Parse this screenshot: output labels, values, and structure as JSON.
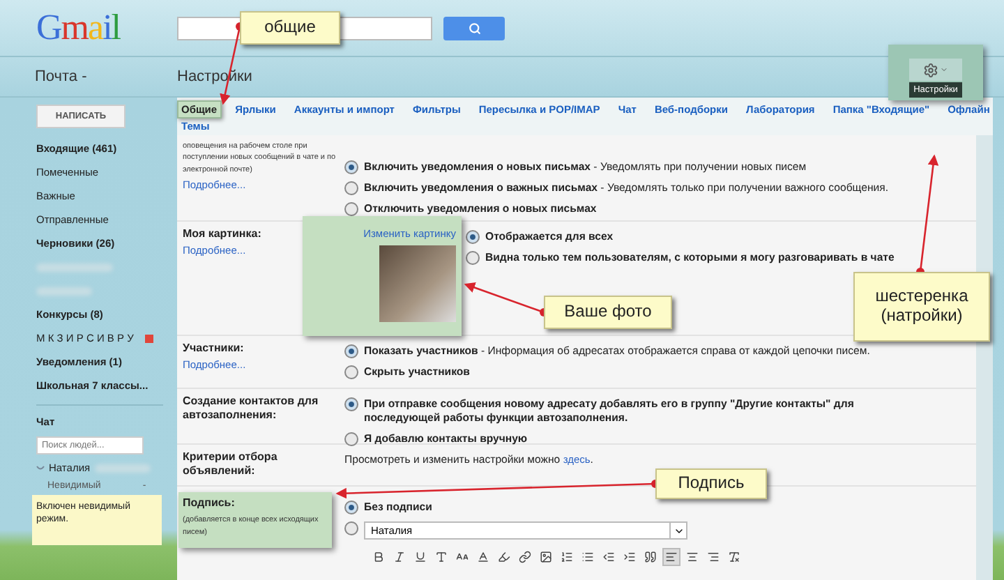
{
  "header": {
    "logo": "Gmail"
  },
  "nav": {
    "mail_label": "Почта -",
    "page_title": "Настройки",
    "settings_tooltip": "Настройки"
  },
  "sidebar": {
    "compose": "НАПИСАТЬ",
    "folders": [
      {
        "kind": "folder",
        "label": "Входящие (461)",
        "bold": true
      },
      {
        "kind": "folder",
        "label": "Помеченные",
        "bold": false
      },
      {
        "kind": "folder",
        "label": "Важные",
        "bold": false
      },
      {
        "kind": "folder",
        "label": "Отправленные",
        "bold": false
      },
      {
        "kind": "folder",
        "label": "Черновики (26)",
        "bold": true
      },
      {
        "kind": "redacted"
      },
      {
        "kind": "redacted"
      },
      {
        "kind": "folder",
        "label": "Конкурсы (8)",
        "bold": true
      },
      {
        "kind": "folder",
        "label": "М К З И Р С И В Р У",
        "bold": false,
        "color": "#e0463b"
      },
      {
        "kind": "folder",
        "label": "Уведомления (1)",
        "bold": true
      },
      {
        "kind": "folder",
        "label": "Школьная 7 классы...",
        "bold": true
      }
    ],
    "chat": {
      "title": "Чат",
      "search": {
        "placeholder": "Поиск людей..."
      },
      "contact": "Наталия",
      "status": "Невидимый",
      "status_caret": "-",
      "notice": "Включен невидимый режим."
    }
  },
  "tab_rows": [
    {
      "tabs": [
        {
          "label": "Общие",
          "selected": true
        },
        {
          "label": "Ярлыки",
          "selected": false
        },
        {
          "label": "Аккаунты и импорт",
          "selected": false
        },
        {
          "label": "Фильтры",
          "selected": false
        },
        {
          "label": "Пересылка и POP/IMAP",
          "selected": false
        },
        {
          "label": "Чат",
          "selected": false
        },
        {
          "label": "Веб-подборки",
          "selected": false
        },
        {
          "label": "Лаборатория",
          "selected": false
        },
        {
          "label": "Папка \"Входящие\"",
          "selected": false
        },
        {
          "label": "Офлайн",
          "selected": false
        }
      ]
    },
    {
      "tabs": [
        {
          "label": "Темы",
          "selected": false
        }
      ]
    }
  ],
  "sections": [
    {
      "kind": "radios",
      "note": "оповещения на рабочем столе при поступлении новых сообщений в чате и по электронной почте)",
      "more": "Подробнее...",
      "options": [
        {
          "title": "Включить уведомления о новых письмах",
          "description": "- Уведомлять при получении новых писем",
          "selected": true
        },
        {
          "title": "Включить уведомления о важных письмах",
          "description": "- Уведомлять только при получении важного сообщения.",
          "selected": false
        },
        {
          "title": "Отключить уведомления о новых письмах",
          "selected": false
        }
      ]
    },
    {
      "kind": "picture",
      "label": "Моя картинка:",
      "more": "Подробнее...",
      "change_link": "Изменить картинку",
      "options": [
        {
          "title": "Отображается для всех",
          "selected": true
        },
        {
          "title": "Видна только тем пользователям, с которыми я могу разговаривать в чате",
          "selected": false
        }
      ]
    },
    {
      "kind": "radios",
      "label": "Участники:",
      "more": "Подробнее...",
      "options": [
        {
          "title": "Показать участников",
          "description": "- Информация об адресатах отображается справа от каждой цепочки писем.",
          "selected": true
        },
        {
          "title": "Скрыть участников",
          "selected": false
        }
      ]
    },
    {
      "kind": "radios",
      "label": "Создание контактов для автозаполнения:",
      "options": [
        {
          "title": "При отправке сообщения новому адресату добавлять его в группу \"Другие контакты\" для последующей работы функции автозаполнения.",
          "selected": true
        },
        {
          "title": "Я добавлю контакты вручную",
          "selected": false
        }
      ]
    },
    {
      "kind": "link_text",
      "label": "Критерии отбора объявлений:",
      "text_before": "Просмотреть и изменить настройки можно",
      "link": "здесь",
      "text_after": "."
    },
    {
      "kind": "signature",
      "label": "Подпись:",
      "note": "(добавляется в конце всех исходящих писем)",
      "options": [
        {
          "title": "Без подписи",
          "selected": true
        },
        {
          "select_value": "Наталия",
          "selected": false
        }
      ],
      "toolbar": [
        {
          "kind": "bold",
          "selected": false
        },
        {
          "kind": "italic",
          "selected": false
        },
        {
          "kind": "underline",
          "selected": false
        },
        {
          "kind": "font",
          "selected": false
        },
        {
          "kind": "size",
          "selected": false
        },
        {
          "kind": "text-color",
          "selected": false
        },
        {
          "kind": "highlight",
          "selected": false
        },
        {
          "kind": "link",
          "selected": false
        },
        {
          "kind": "image",
          "selected": false
        },
        {
          "kind": "numbered-list",
          "selected": false
        },
        {
          "kind": "bulleted-list",
          "selected": false
        },
        {
          "kind": "indent-less",
          "selected": false
        },
        {
          "kind": "indent-more",
          "selected": false
        },
        {
          "kind": "quote",
          "selected": false
        },
        {
          "kind": "align-left",
          "selected": true
        },
        {
          "kind": "align-center",
          "selected": false
        },
        {
          "kind": "align-right",
          "selected": false
        },
        {
          "kind": "clear-format",
          "selected": false
        }
      ]
    }
  ],
  "annotations": [
    {
      "text": "общие"
    },
    {
      "text": "Ваше фото"
    },
    {
      "text": "шестеренка (натройки)"
    },
    {
      "text": "Подпись"
    }
  ]
}
